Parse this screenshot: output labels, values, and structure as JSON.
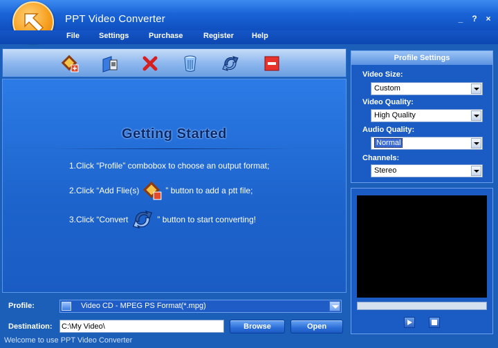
{
  "window": {
    "title": "PPT Video Converter",
    "controls": {
      "minimize": "_",
      "help": "?",
      "close": "×"
    }
  },
  "menu": [
    "File",
    "Settings",
    "Purchase",
    "Register",
    "Help"
  ],
  "toolbar": {
    "icons": [
      "add-file-icon",
      "export-icon",
      "delete-icon",
      "recycle-bin-icon",
      "convert-icon",
      "stop-icon"
    ]
  },
  "getting_started": {
    "title": "Getting Started",
    "step1": "1.Click “Profile” combobox to choose an output format;",
    "step2_before": "2.Click “Add Flie(s)",
    "step2_after": "” button to add a ptt file;",
    "step3_before": "3.Click “Convert",
    "step3_after": "” button to start converting!"
  },
  "profile_settings": {
    "header": "Profile Settings",
    "video_size_label": "Video Size:",
    "video_size_value": "Custom",
    "video_quality_label": "Video Quality:",
    "video_quality_value": "High Quality",
    "audio_quality_label": "Audio Quality:",
    "audio_quality_value": "Normal",
    "channels_label": "Channels:",
    "channels_value": "Stereo"
  },
  "bottom": {
    "profile_label": "Profile:",
    "profile_value": "Video CD - MPEG PS Format(*.mpg)",
    "destination_label": "Destination:",
    "destination_value": "C:\\My Video\\",
    "browse_label": "Browse",
    "open_label": "Open"
  },
  "status": "Welcome to use PPT Video Converter",
  "colors": {
    "accent": "#1c5fb8",
    "toolbar": "#8fb8ee",
    "preview": "#000000"
  }
}
